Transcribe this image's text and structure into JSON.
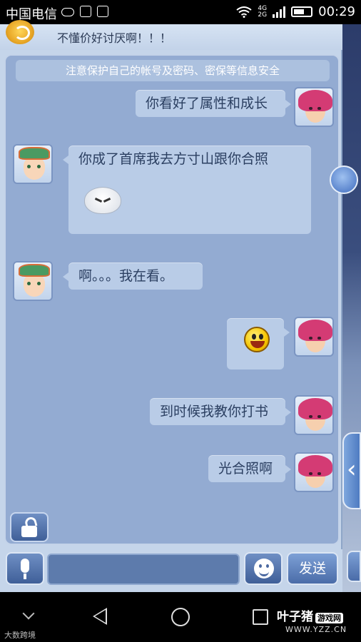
{
  "status_bar": {
    "carrier": "中国电信",
    "network": "4G",
    "network2": "2G",
    "time": "00:29"
  },
  "chat": {
    "top_preview": "不懂价好讨厌啊！！！",
    "notice": "注意保护自己的帐号及密码、密保等信息安全",
    "messages": [
      {
        "side": "right",
        "text": "你看好了属性和成长"
      },
      {
        "side": "left",
        "text": "你成了首席我去方寸山跟你合照",
        "emoji": "dumpling-emoji"
      },
      {
        "side": "left",
        "text": "啊。。。我在看。"
      },
      {
        "side": "right",
        "text": "",
        "emoji": "smile-emoji"
      },
      {
        "side": "right",
        "text": "到时候我教你打书"
      },
      {
        "side": "right",
        "text": "光合照啊"
      }
    ]
  },
  "input_bar": {
    "value": "",
    "send_label": "发送"
  },
  "watermark": {
    "left": "大数跨境",
    "brand": "叶子猪",
    "tag": "游戏网",
    "url": "WWW.YZZ.CN"
  },
  "colors": {
    "panel_bg": "#c5d5ea",
    "chat_bg": "#93abd2",
    "bubble_bg": "#b9cce7",
    "button_blue": "#4a6ca8"
  }
}
